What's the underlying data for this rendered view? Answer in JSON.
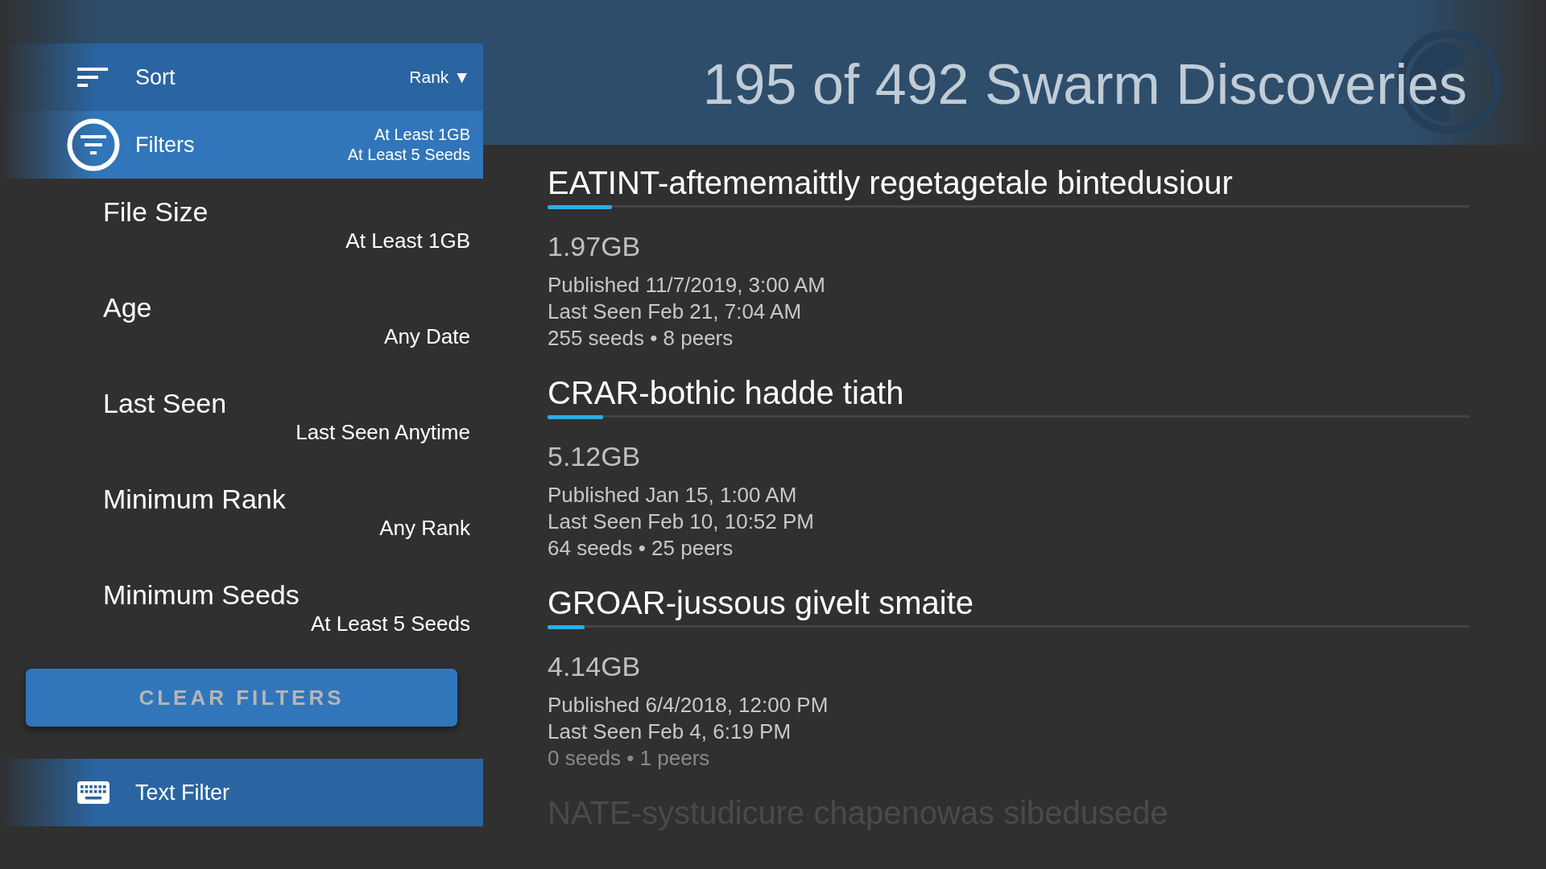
{
  "header": {
    "title": "195 of 492 Swarm Discoveries"
  },
  "sidebar": {
    "sort": {
      "label": "Sort",
      "value": "Rank ▼",
      "selected": false
    },
    "filters": {
      "label": "Filters",
      "summary": [
        "At Least 1GB",
        "At Least 5 Seeds"
      ],
      "selected": true
    },
    "filter_items": [
      {
        "label": "File Size",
        "value": "At Least 1GB"
      },
      {
        "label": "Age",
        "value": "Any Date"
      },
      {
        "label": "Last Seen",
        "value": "Last Seen Anytime"
      },
      {
        "label": "Minimum Rank",
        "value": "Any Rank"
      },
      {
        "label": "Minimum Seeds",
        "value": "At Least 5 Seeds"
      }
    ],
    "clear_button": "CLEAR FILTERS",
    "text_filter": {
      "label": "Text Filter",
      "selected": false
    }
  },
  "results": [
    {
      "title": "EATINT-aftememaittly regetagetale bintedusiour",
      "level": 0.07,
      "size": "1.97GB",
      "published": "Published 11/7/2019, 3:00 AM",
      "last_seen": "Last Seen Feb 21, 7:04 AM",
      "swarm": "255 seeds • 8 peers",
      "dimmed": false,
      "faded": false
    },
    {
      "title": "CRAR-bothic hadde tiath",
      "level": 0.06,
      "size": "5.12GB",
      "published": "Published Jan 15, 1:00 AM",
      "last_seen": "Last Seen Feb 10, 10:52 PM",
      "swarm": "64 seeds • 25 peers",
      "dimmed": false,
      "faded": false
    },
    {
      "title": "GROAR-jussous givelt smaite",
      "level": 0.04,
      "size": "4.14GB",
      "published": "Published 6/4/2018, 12:00 PM",
      "last_seen": "Last Seen Feb 4, 6:19 PM",
      "swarm": "0 seeds • 1 peers",
      "dimmed": true,
      "faded": false
    },
    {
      "title": "NATE-systudicure chapenowas sibedusede",
      "faded": true
    }
  ]
}
